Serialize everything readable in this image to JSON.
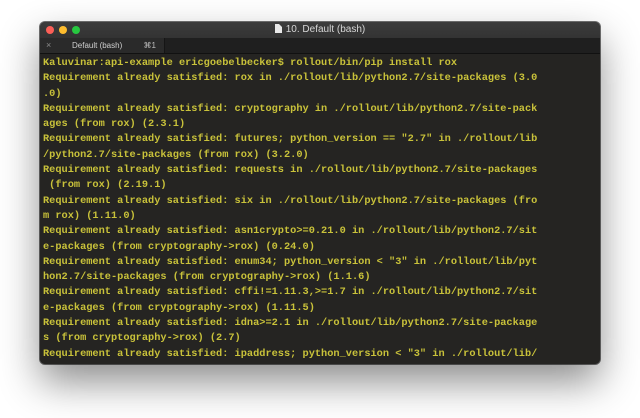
{
  "window": {
    "title": "10. Default (bash)"
  },
  "tab": {
    "close_glyph": "×",
    "label": "Default (bash)",
    "shortcut": "⌘1"
  },
  "colors": {
    "terminal_text": "#c9c23a",
    "terminal_bg": "#252422"
  },
  "terminal": {
    "lines": [
      "Kaluvinar:api-example ericgoebelbecker$ rollout/bin/pip install rox",
      "Requirement already satisfied: rox in ./rollout/lib/python2.7/site-packages (3.0",
      ".0)",
      "Requirement already satisfied: cryptography in ./rollout/lib/python2.7/site-pack",
      "ages (from rox) (2.3.1)",
      "Requirement already satisfied: futures; python_version == \"2.7\" in ./rollout/lib",
      "/python2.7/site-packages (from rox) (3.2.0)",
      "Requirement already satisfied: requests in ./rollout/lib/python2.7/site-packages",
      " (from rox) (2.19.1)",
      "Requirement already satisfied: six in ./rollout/lib/python2.7/site-packages (fro",
      "m rox) (1.11.0)",
      "Requirement already satisfied: asn1crypto>=0.21.0 in ./rollout/lib/python2.7/sit",
      "e-packages (from cryptography->rox) (0.24.0)",
      "Requirement already satisfied: enum34; python_version < \"3\" in ./rollout/lib/pyt",
      "hon2.7/site-packages (from cryptography->rox) (1.1.6)",
      "Requirement already satisfied: cffi!=1.11.3,>=1.7 in ./rollout/lib/python2.7/sit",
      "e-packages (from cryptography->rox) (1.11.5)",
      "Requirement already satisfied: idna>=2.1 in ./rollout/lib/python2.7/site-package",
      "s (from cryptography->rox) (2.7)",
      "Requirement already satisfied: ipaddress; python_version < \"3\" in ./rollout/lib/"
    ]
  }
}
